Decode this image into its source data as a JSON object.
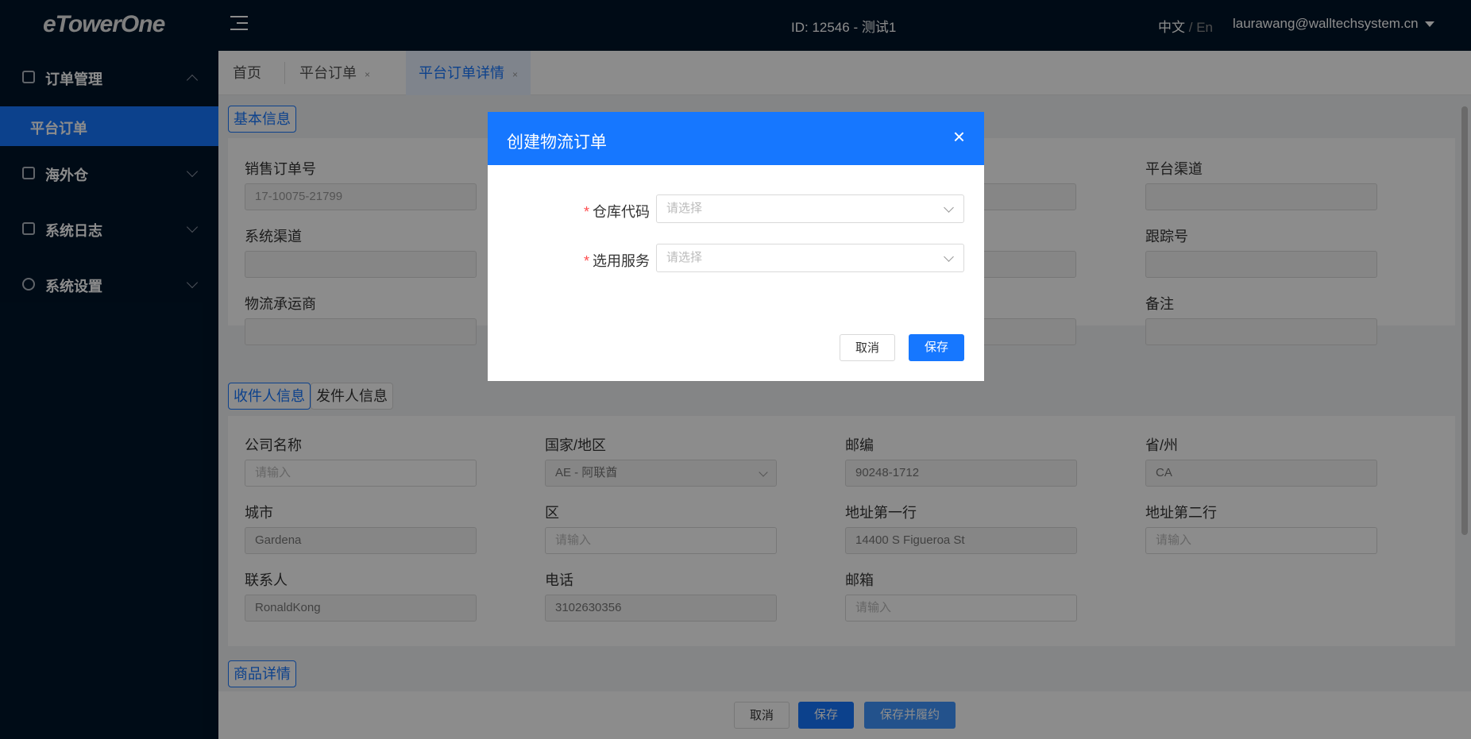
{
  "header": {
    "logo": "eTowerOne",
    "session_id": "ID: 12546 - 测试1",
    "lang_zh": "中文",
    "lang_sep": "/",
    "lang_en": "En",
    "user": "laurawang@walltechsystem.cn"
  },
  "sidebar": {
    "items": [
      {
        "label": "订单管理"
      },
      {
        "label": "平台订单"
      },
      {
        "label": "海外仓"
      },
      {
        "label": "系统日志"
      },
      {
        "label": "系统设置"
      }
    ]
  },
  "tabs": [
    {
      "label": "首页"
    },
    {
      "label": "平台订单"
    },
    {
      "label": "平台订单详情"
    }
  ],
  "basic": {
    "title": "基本信息",
    "fields": [
      {
        "label": "销售订单号",
        "value": "17-10075-21799"
      },
      {
        "label": "平台渠道",
        "value": ""
      },
      {
        "label": "系统渠道",
        "value": ""
      },
      {
        "label": "跟踪号",
        "value": ""
      },
      {
        "label": "物流承运商",
        "value": ""
      },
      {
        "label": "备注",
        "value": ""
      }
    ]
  },
  "party": {
    "tab_recipient": "收件人信息",
    "tab_sender": "发件人信息",
    "fields": [
      {
        "label": "公司名称",
        "value": "",
        "placeholder": "请输入"
      },
      {
        "label": "国家/地区",
        "value": "AE - 阿联酋"
      },
      {
        "label": "邮编",
        "value": "90248-1712"
      },
      {
        "label": "省/州",
        "value": "CA"
      },
      {
        "label": "城市",
        "value": "Gardena"
      },
      {
        "label": "区",
        "value": "",
        "placeholder": "请输入"
      },
      {
        "label": "地址第一行",
        "value": "14400 S Figueroa St"
      },
      {
        "label": "地址第二行",
        "value": "",
        "placeholder": "请输入"
      },
      {
        "label": "联系人",
        "value": "RonaldKong"
      },
      {
        "label": "电话",
        "value": "3102630356"
      },
      {
        "label": "邮箱",
        "value": "",
        "placeholder": "请输入"
      }
    ]
  },
  "goods": {
    "title": "商品详情"
  },
  "footer": {
    "cancel": "取消",
    "save": "保存",
    "save_fulfill": "保存并履约"
  },
  "modal": {
    "title": "创建物流订单",
    "close": "×",
    "required_mark": "*",
    "warehouse_label": "仓库代码",
    "warehouse_placeholder": "请选择",
    "service_label": "选用服务",
    "service_placeholder": "请选择",
    "cancel": "取消",
    "save": "保存"
  },
  "colors": {
    "primary": "#1677ff",
    "sidebar_bg": "#001529",
    "required": "#ff4d4f"
  }
}
